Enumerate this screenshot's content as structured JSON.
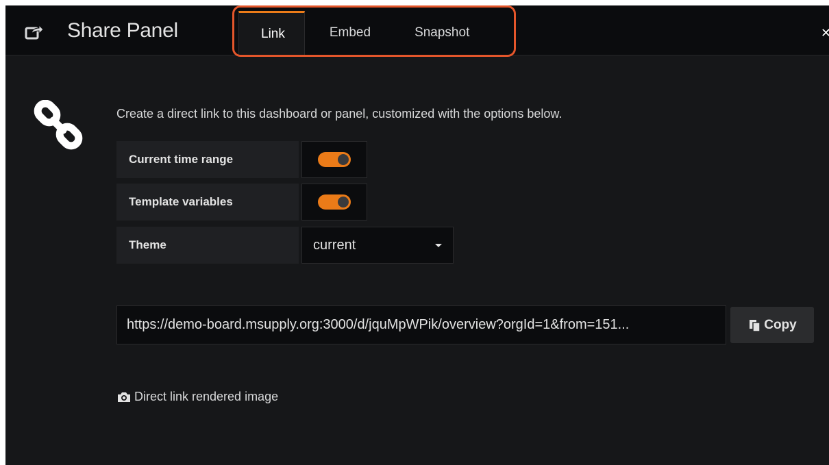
{
  "header": {
    "title": "Share Panel",
    "tabs": [
      {
        "label": "Link",
        "active": true
      },
      {
        "label": "Embed",
        "active": false
      },
      {
        "label": "Snapshot",
        "active": false
      }
    ],
    "close_icon": "close-icon"
  },
  "body": {
    "description": "Create a direct link to this dashboard or panel, customized with the options below.",
    "options": {
      "time_range": {
        "label": "Current time range",
        "enabled": true
      },
      "template_vars": {
        "label": "Template variables",
        "enabled": true
      },
      "theme": {
        "label": "Theme",
        "value": "current"
      }
    },
    "url": {
      "value": "https://demo-board.msupply.org:3000/d/jquMpWPik/overview?orgId=1&from=151..."
    },
    "copy_button": "Copy",
    "render_link": "Direct link rendered image"
  },
  "colors": {
    "accent": "#eb7b18",
    "highlight_annotation": "#e4562b",
    "background": "#161719",
    "header_background": "#0b0c0e"
  }
}
